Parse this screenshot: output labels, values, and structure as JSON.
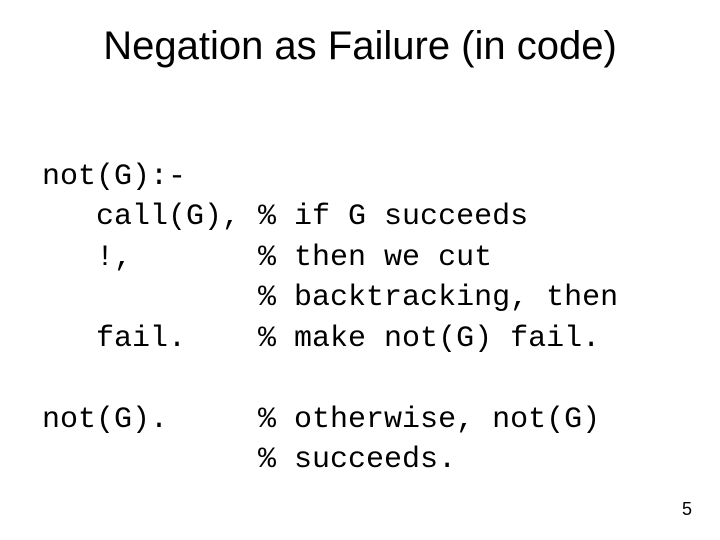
{
  "title": "Negation as Failure (in code)",
  "code": {
    "l1": "not(G):-",
    "l2": "   call(G), % if G succeeds",
    "l3": "   !,       % then we cut",
    "l4": "            % backtracking, then",
    "l5": "   fail.    % make not(G) fail.",
    "l6": "",
    "l7": "not(G).     % otherwise, not(G)",
    "l8": "            % succeeds."
  },
  "page_number": "5"
}
